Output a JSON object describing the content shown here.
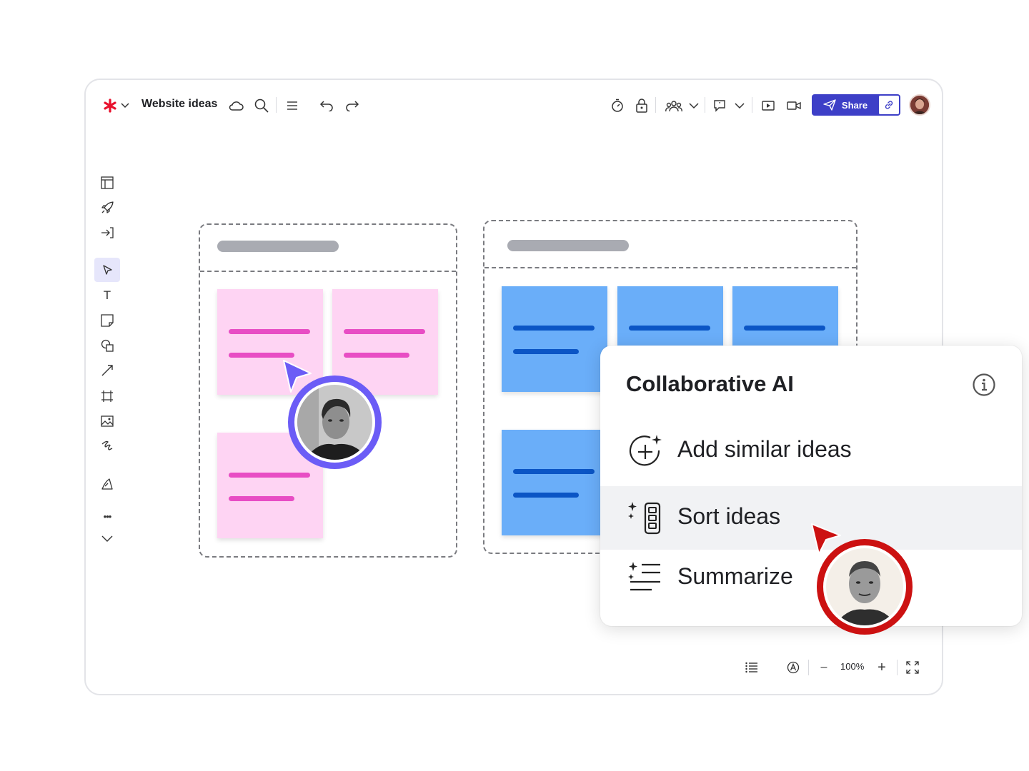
{
  "app": {
    "board_title": "Website ideas",
    "logo_icon": "asterisk-logo-icon",
    "accent": "#e8112d"
  },
  "toolbar": {
    "left_icons": [
      "chevron-down-icon",
      "cloud-icon",
      "search-icon",
      "menu-icon",
      "undo-icon",
      "redo-icon"
    ],
    "right_icons": [
      "timer-icon",
      "lock-icon",
      "collaborators-icon",
      "chevron-down-icon",
      "comment-icon",
      "chevron-down-icon",
      "present-icon",
      "video-icon"
    ],
    "share_label": "Share",
    "share_color": "#3d3fc7"
  },
  "sidebar": {
    "items": [
      "panel-icon",
      "rocket-icon",
      "import-icon",
      "select-icon",
      "text-icon",
      "sticky-note-icon",
      "shapes-icon",
      "connector-icon",
      "frame-icon",
      "image-icon",
      "pen-icon",
      "templates-icon",
      "more-icon",
      "chevron-down-icon"
    ],
    "text_glyph": "T",
    "more_glyph": "•••"
  },
  "boards": {
    "left_color": "#fed4f3",
    "right_color": "#6aaef9"
  },
  "ai_panel": {
    "title": "Collaborative AI",
    "items": [
      {
        "label": "Add similar ideas",
        "icon": "add-sparkle-icon"
      },
      {
        "label": "Sort ideas",
        "icon": "sort-sparkle-icon",
        "highlighted": true
      },
      {
        "label": "Summarize",
        "icon": "summarize-sparkle-icon"
      }
    ]
  },
  "cursors": {
    "purple": "#6b5cf6",
    "red": "#cc1111"
  },
  "bottombar": {
    "zoom": "100%",
    "minus": "–",
    "plus": "+"
  }
}
